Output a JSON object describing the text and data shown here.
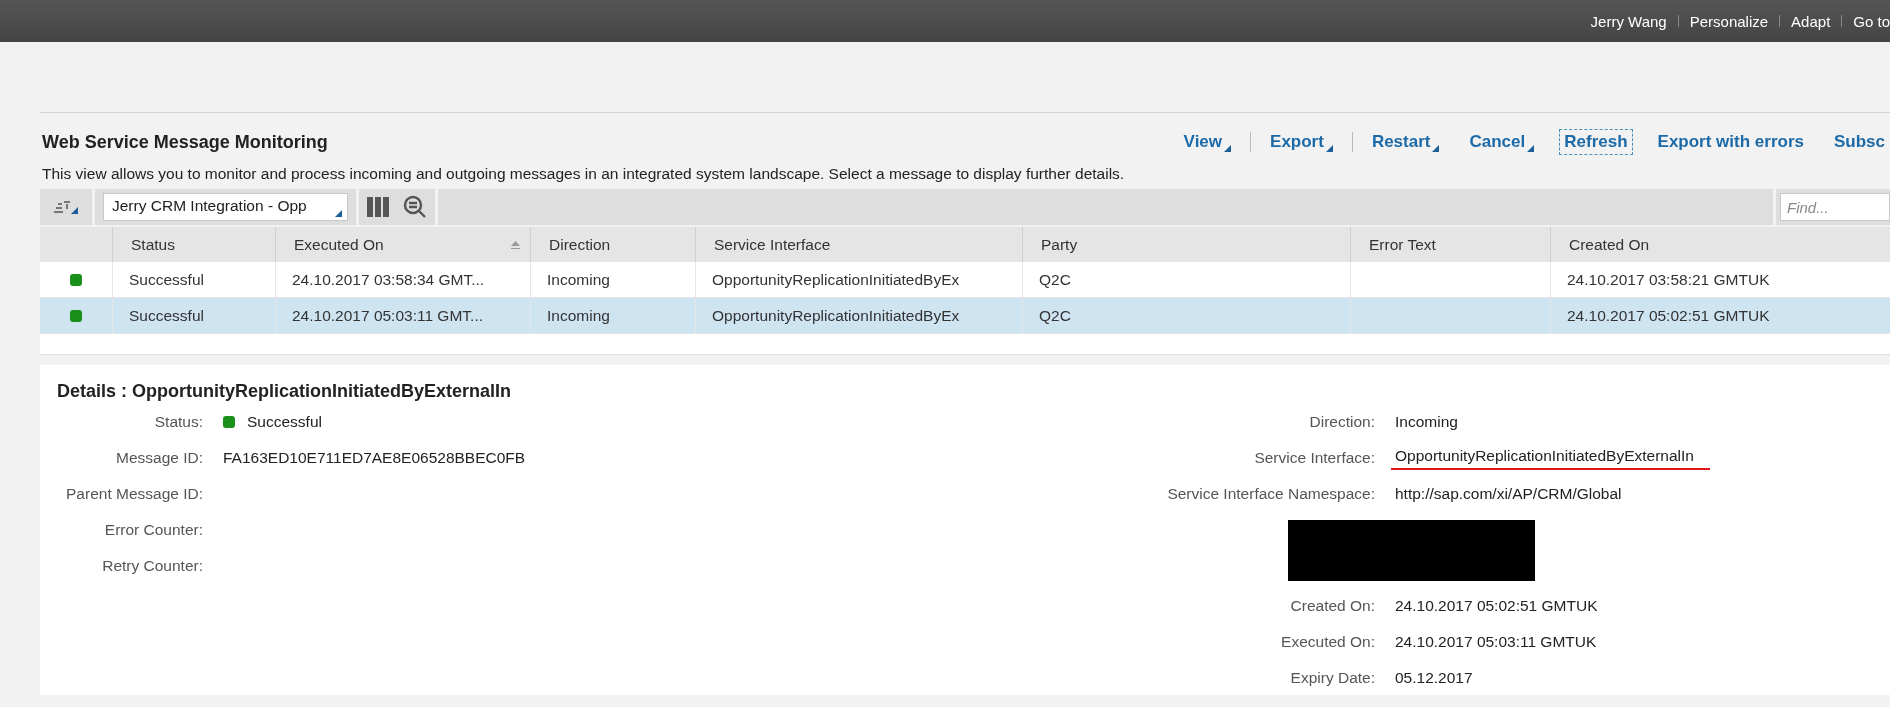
{
  "top_bar": {
    "items": [
      "Jerry Wang",
      "Personalize",
      "Adapt",
      "Go to"
    ]
  },
  "header": {
    "title": "Web Service Message Monitoring",
    "description": "This view allows you to monitor and process incoming and outgoing messages in an integrated system landscape. Select a message to display further details.",
    "action_groups": [
      [
        {
          "label": "View",
          "has_menu": true,
          "focused": false
        }
      ],
      [
        {
          "label": "Export",
          "has_menu": true,
          "focused": false
        }
      ],
      [
        {
          "label": "Restart",
          "has_menu": true,
          "focused": false
        },
        {
          "label": "Cancel",
          "has_menu": true,
          "focused": false
        },
        {
          "label": "Refresh",
          "has_menu": false,
          "focused": true
        },
        {
          "label": "Export with errors",
          "has_menu": false,
          "focused": false
        },
        {
          "label": "Subsc",
          "has_menu": false,
          "focused": false
        }
      ]
    ]
  },
  "toolbar": {
    "variant": "Jerry CRM Integration - Opp",
    "search": {
      "placeholder": "Find..."
    }
  },
  "table": {
    "columns": [
      {
        "label": "Status",
        "sorted": false
      },
      {
        "label": "Executed On",
        "sorted": true
      },
      {
        "label": "Direction",
        "sorted": false
      },
      {
        "label": "Service Interface",
        "sorted": false
      },
      {
        "label": "Party",
        "sorted": false
      },
      {
        "label": "Error Text",
        "sorted": false
      },
      {
        "label": "Created On",
        "sorted": false
      }
    ],
    "rows": [
      {
        "selected": false,
        "color": "#1a8f1a",
        "cells": [
          "Successful",
          "24.10.2017 03:58:34 GMT...",
          "Incoming",
          "OpportunityReplicationInitiatedByEx",
          "Q2C",
          "",
          "24.10.2017 03:58:21 GMTUK"
        ]
      },
      {
        "selected": true,
        "color": "#1a8f1a",
        "cells": [
          "Successful",
          "24.10.2017 05:03:11 GMT...",
          "Incoming",
          "OpportunityReplicationInitiatedByEx",
          "Q2C",
          "",
          "24.10.2017 05:02:51 GMTUK"
        ]
      }
    ]
  },
  "details": {
    "title": "Details : OpportunityReplicationInitiatedByExternalIn",
    "left": [
      {
        "kind": "status",
        "label": "Status:",
        "value": "Successful",
        "color": "#1a8f1a"
      },
      {
        "kind": "text",
        "label": "Message ID:",
        "value": "FA163ED10E711ED7AE8E06528BBEC0FB"
      },
      {
        "kind": "text",
        "label": "Parent Message ID:"
      },
      {
        "kind": "text",
        "label": "Error Counter:"
      },
      {
        "kind": "text",
        "label": "Retry Counter:"
      }
    ],
    "right": [
      {
        "kind": "text",
        "label": "Direction:",
        "value": "Incoming"
      },
      {
        "kind": "text",
        "label": "Service Interface:",
        "value": "OpportunityReplicationInitiatedByExternalIn",
        "underlined": true
      },
      {
        "kind": "text",
        "label": "Service Interface Namespace:",
        "value": "http://sap.com/xi/AP/CRM/Global"
      },
      {
        "kind": "redacted"
      },
      {
        "kind": "text",
        "label": "Created On:",
        "value": "24.10.2017 05:02:51 GMTUK"
      },
      {
        "kind": "text",
        "label": "Executed On:",
        "value": "24.10.2017 05:03:11 GMTUK"
      },
      {
        "kind": "text",
        "label": "Expiry Date:",
        "value": "05.12.2017"
      }
    ]
  }
}
